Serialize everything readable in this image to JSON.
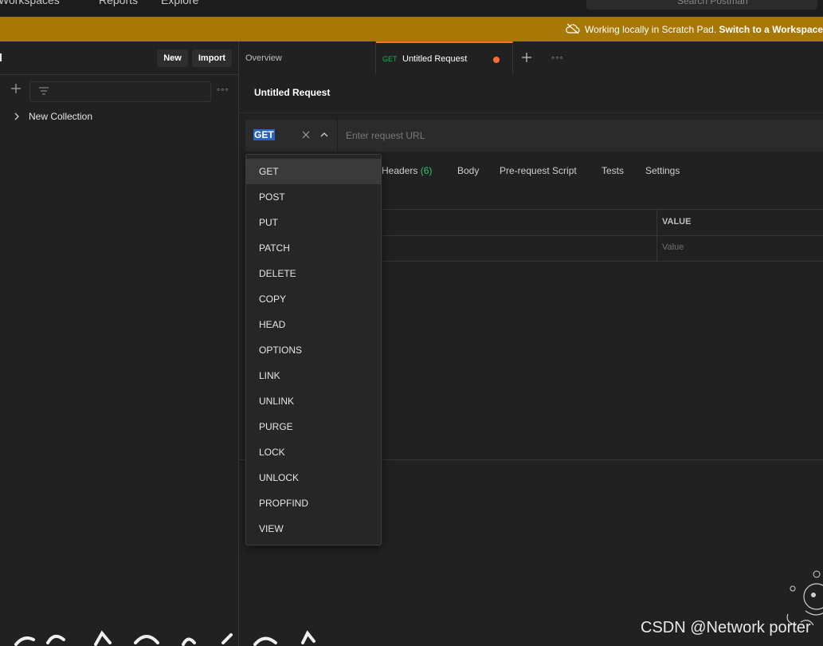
{
  "topbar": {
    "nav": [
      "Workspaces",
      "Reports",
      "Explore"
    ],
    "search_placeholder": "Search Postman"
  },
  "banner": {
    "text": "Working locally in Scratch Pad. ",
    "link": "Switch to a Workspace"
  },
  "sidebar": {
    "new_label": "New",
    "import_label": "Import",
    "collection_name": "New Collection"
  },
  "tabs": {
    "overview": "Overview",
    "active_method": "GET",
    "active_title": "Untitled Request"
  },
  "request": {
    "title": "Untitled Request",
    "method": "GET",
    "url_placeholder": "Enter request URL"
  },
  "subtabs": {
    "headers": "Headers",
    "headers_count": "(6)",
    "body": "Body",
    "prerequest": "Pre-request Script",
    "tests": "Tests",
    "settings": "Settings"
  },
  "table": {
    "value_header": "VALUE",
    "value_placeholder": "Value"
  },
  "methods": [
    "GET",
    "POST",
    "PUT",
    "PATCH",
    "DELETE",
    "COPY",
    "HEAD",
    "OPTIONS",
    "LINK",
    "UNLINK",
    "PURGE",
    "LOCK",
    "UNLOCK",
    "PROPFIND",
    "VIEW"
  ],
  "watermark": "CSDN @Network porter",
  "colors": {
    "accent": "#ff6c37",
    "banner": "#a87807",
    "get_green": "#0cbb52"
  }
}
